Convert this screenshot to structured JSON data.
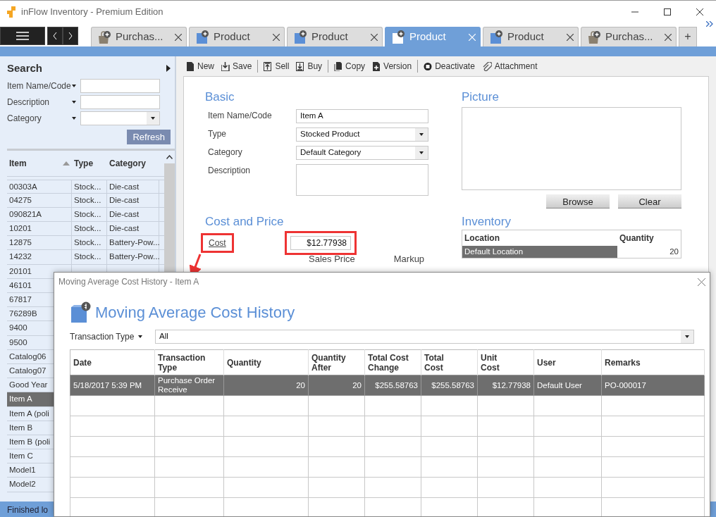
{
  "window": {
    "title": "inFlow Inventory - Premium Edition"
  },
  "tabs": [
    {
      "label": "Purchas...",
      "kind": "purchase",
      "selected": false
    },
    {
      "label": "Product",
      "kind": "product",
      "selected": false
    },
    {
      "label": "Product",
      "kind": "product",
      "selected": false
    },
    {
      "label": "Product",
      "kind": "product",
      "selected": true
    },
    {
      "label": "Product",
      "kind": "product",
      "selected": false
    },
    {
      "label": "Purchas...",
      "kind": "purchase",
      "selected": false
    }
  ],
  "new_tab_button": "+",
  "toolbar": [
    {
      "label": "New",
      "kind": "new",
      "separator_after": false
    },
    {
      "label": "Save",
      "kind": "save",
      "separator_after": true
    },
    {
      "label": "Sell",
      "kind": "sell",
      "separator_after": false
    },
    {
      "label": "Buy",
      "kind": "buy",
      "separator_after": true
    },
    {
      "label": "Copy",
      "kind": "copy",
      "separator_after": false
    },
    {
      "label": "Version",
      "kind": "version",
      "separator_after": true
    },
    {
      "label": "Deactivate",
      "kind": "deactivate",
      "separator_after": false
    },
    {
      "label": "Attachment",
      "kind": "attachment",
      "separator_after": false
    }
  ],
  "search": {
    "title": "Search",
    "filters": [
      {
        "label": "Item Name/Code",
        "kind": "text"
      },
      {
        "label": "Description",
        "kind": "text"
      },
      {
        "label": "Category",
        "kind": "select"
      }
    ],
    "button": "Refresh"
  },
  "item_list": {
    "columns": [
      "Item",
      "Type",
      "Category"
    ],
    "rows": [
      {
        "cells": [
          "00303A",
          "Stock...",
          "Die-cast"
        ],
        "selected": false
      },
      {
        "cells": [
          "04275",
          "Stock...",
          "Die-cast"
        ],
        "selected": false
      },
      {
        "cells": [
          "090821A",
          "Stock...",
          "Die-cast"
        ],
        "selected": false
      },
      {
        "cells": [
          "10201",
          "Stock...",
          "Die-cast"
        ],
        "selected": false
      },
      {
        "cells": [
          "12875",
          "Stock...",
          "Battery-Pow..."
        ],
        "selected": false
      },
      {
        "cells": [
          "14232",
          "Stock...",
          "Battery-Pow..."
        ],
        "selected": false
      },
      {
        "cells": [
          "20101"
        ],
        "selected": false
      },
      {
        "cells": [
          "46101"
        ],
        "selected": false
      },
      {
        "cells": [
          "67817"
        ],
        "selected": false
      },
      {
        "cells": [
          "76289B"
        ],
        "selected": false
      },
      {
        "cells": [
          "9400"
        ],
        "selected": false
      },
      {
        "cells": [
          "9500"
        ],
        "selected": false
      },
      {
        "cells": [
          "Catalog06"
        ],
        "selected": false
      },
      {
        "cells": [
          "Catalog07"
        ],
        "selected": false
      },
      {
        "cells": [
          "Good Year"
        ],
        "selected": false
      },
      {
        "cells": [
          "Item A"
        ],
        "selected": true
      },
      {
        "cells": [
          "Item A (poli"
        ],
        "selected": false
      },
      {
        "cells": [
          "Item B"
        ],
        "selected": false
      },
      {
        "cells": [
          "Item B (poli"
        ],
        "selected": false
      },
      {
        "cells": [
          "Item C"
        ],
        "selected": false
      },
      {
        "cells": [
          "Model1"
        ],
        "selected": false
      },
      {
        "cells": [
          "Model2"
        ],
        "selected": false
      }
    ]
  },
  "status_bar": "Finished lo",
  "basic": {
    "title": "Basic",
    "fields": [
      {
        "label": "Item Name/Code",
        "kind": "text",
        "value": "Item A"
      },
      {
        "label": "Type",
        "kind": "select",
        "value": "Stocked Product"
      },
      {
        "label": "Category",
        "kind": "select",
        "value": "Default Category"
      },
      {
        "label": "Description",
        "kind": "textarea"
      }
    ]
  },
  "cost_and_price": {
    "title": "Cost and Price",
    "cost_label": "Cost",
    "cost": "$12.77938",
    "columns": [
      "Sales Price",
      "Markup"
    ]
  },
  "picture": {
    "title": "Picture",
    "buttons": [
      "Browse",
      "Clear"
    ]
  },
  "inventory": {
    "title": "Inventory",
    "columns": [
      "Location",
      "Quantity"
    ],
    "rows": [
      {
        "cells": [
          "Default Location",
          "20"
        ],
        "selected": true
      }
    ]
  },
  "dialog": {
    "title": "Moving Average Cost History - Item A",
    "heading": "Moving Average Cost History",
    "filter": {
      "label": "Transaction Type",
      "value": "All"
    },
    "table": {
      "columns": [
        "Date",
        "Transaction\nType",
        "Quantity",
        "Quantity\nAfter",
        "Total Cost\nChange",
        "Total\nCost",
        "Unit\nCost",
        "User",
        "Remarks"
      ],
      "rows": [
        {
          "cells": [
            "5/18/2017 5:39 PM",
            "Purchase Order\nReceive",
            "20",
            "20",
            "$255.58763",
            "$255.58763",
            "$12.77938",
            "Default User",
            "PO-000017"
          ],
          "selected": true
        }
      ]
    }
  }
}
